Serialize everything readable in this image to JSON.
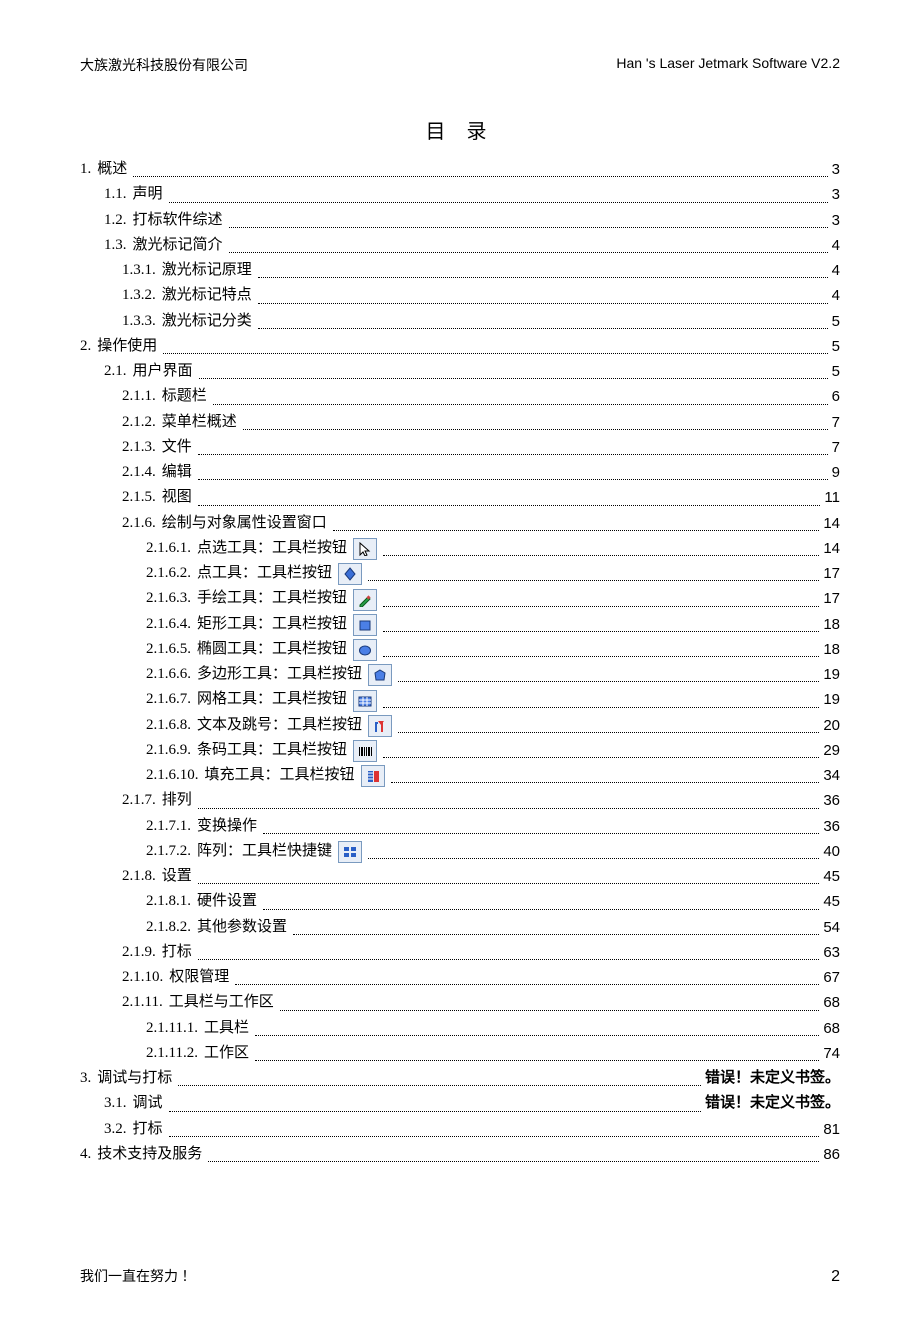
{
  "header": {
    "left": "大族激光科技股份有限公司",
    "right": "Han 's Laser Jetmark Software V2.2"
  },
  "title": "目 录",
  "toc": [
    {
      "level": 0,
      "num": "1.",
      "text": "概述",
      "page": "3"
    },
    {
      "level": 1,
      "num": "1.1.",
      "text": "声明",
      "page": "3"
    },
    {
      "level": 1,
      "num": "1.2.",
      "text": "打标软件综述",
      "page": "3"
    },
    {
      "level": 1,
      "num": "1.3.",
      "text": "激光标记简介",
      "page": "4"
    },
    {
      "level": 2,
      "num": "1.3.1.",
      "text": "激光标记原理",
      "page": "4"
    },
    {
      "level": 2,
      "num": "1.3.2.",
      "text": "激光标记特点",
      "page": "4"
    },
    {
      "level": 2,
      "num": "1.3.3.",
      "text": "激光标记分类",
      "page": "5"
    },
    {
      "level": 0,
      "num": "2.",
      "text": "操作使用",
      "page": "5"
    },
    {
      "level": 1,
      "num": "2.1.",
      "text": "用户界面",
      "page": "5"
    },
    {
      "level": 2,
      "num": "2.1.1.",
      "text": "标题栏",
      "page": "6"
    },
    {
      "level": 2,
      "num": "2.1.2.",
      "text": "菜单栏概述",
      "page": "7"
    },
    {
      "level": 2,
      "num": "2.1.3.",
      "text": "文件",
      "page": "7"
    },
    {
      "level": 2,
      "num": "2.1.4.",
      "text": "编辑",
      "page": "9"
    },
    {
      "level": 2,
      "num": "2.1.5.",
      "text": "视图",
      "page": "11"
    },
    {
      "level": 2,
      "num": "2.1.6.",
      "text": "绘制与对象属性设置窗口",
      "page": "14"
    },
    {
      "level": 3,
      "num": "2.1.6.1.",
      "text": "点选工具：工具栏按钮",
      "icon": "cursor-icon",
      "page": "14"
    },
    {
      "level": 3,
      "num": "2.1.6.2.",
      "text": "点工具：工具栏按钮",
      "icon": "point-icon",
      "page": "17"
    },
    {
      "level": 3,
      "num": "2.1.6.3.",
      "text": "手绘工具：工具栏按钮",
      "icon": "pencil-icon",
      "page": "17"
    },
    {
      "level": 3,
      "num": "2.1.6.4.",
      "text": "矩形工具：工具栏按钮",
      "icon": "rect-icon",
      "page": "18"
    },
    {
      "level": 3,
      "num": "2.1.6.5.",
      "text": "椭圆工具：工具栏按钮",
      "icon": "ellipse-icon",
      "page": "18"
    },
    {
      "level": 3,
      "num": "2.1.6.6.",
      "text": "多边形工具：工具栏按钮",
      "icon": "polygon-icon",
      "page": "19"
    },
    {
      "level": 3,
      "num": "2.1.6.7.",
      "text": "网格工具：工具栏按钮",
      "icon": "grid-icon",
      "page": "19"
    },
    {
      "level": 3,
      "num": "2.1.6.8.",
      "text": "文本及跳号：工具栏按钮",
      "icon": "text-icon",
      "page": "20"
    },
    {
      "level": 3,
      "num": "2.1.6.9.",
      "text": "条码工具：工具栏按钮",
      "icon": "barcode-icon",
      "page": "29"
    },
    {
      "level": 3,
      "num": "2.1.6.10.",
      "text": "填充工具：工具栏按钮",
      "icon": "fill-icon",
      "page": "34"
    },
    {
      "level": 2,
      "num": "2.1.7.",
      "text": "排列",
      "page": "36"
    },
    {
      "level": 3,
      "num": "2.1.7.1.",
      "text": "变换操作",
      "page": "36"
    },
    {
      "level": 3,
      "num": "2.1.7.2.",
      "text": "阵列：工具栏快捷键",
      "icon": "array-icon",
      "page": "40"
    },
    {
      "level": 2,
      "num": "2.1.8.",
      "text": "设置",
      "page": "45"
    },
    {
      "level": 3,
      "num": "2.1.8.1.",
      "text": "硬件设置",
      "page": "45"
    },
    {
      "level": 3,
      "num": "2.1.8.2.",
      "text": "其他参数设置",
      "page": "54"
    },
    {
      "level": 2,
      "num": "2.1.9.",
      "text": "打标",
      "page": "63"
    },
    {
      "level": 2,
      "num": "2.1.10.",
      "text": "权限管理",
      "page": "67"
    },
    {
      "level": 2,
      "num": "2.1.11.",
      "text": "工具栏与工作区",
      "page": "68"
    },
    {
      "level": 3,
      "num": "2.1.11.1.",
      "text": "工具栏",
      "page": "68"
    },
    {
      "level": 3,
      "num": "2.1.11.2.",
      "text": "工作区",
      "page": "74"
    },
    {
      "level": 0,
      "num": "3.",
      "text": "调试与打标",
      "page_err": "错误！未定义书签。"
    },
    {
      "level": 1,
      "num": "3.1.",
      "text": "调试",
      "page_err": "错误！未定义书签。"
    },
    {
      "level": 1,
      "num": "3.2.",
      "text": "打标",
      "page": "81"
    },
    {
      "level": 0,
      "num": "4.",
      "text": "技术支持及服务",
      "page": "86"
    }
  ],
  "footer": {
    "left": "我们一直在努力  ！",
    "page_number": "2"
  }
}
